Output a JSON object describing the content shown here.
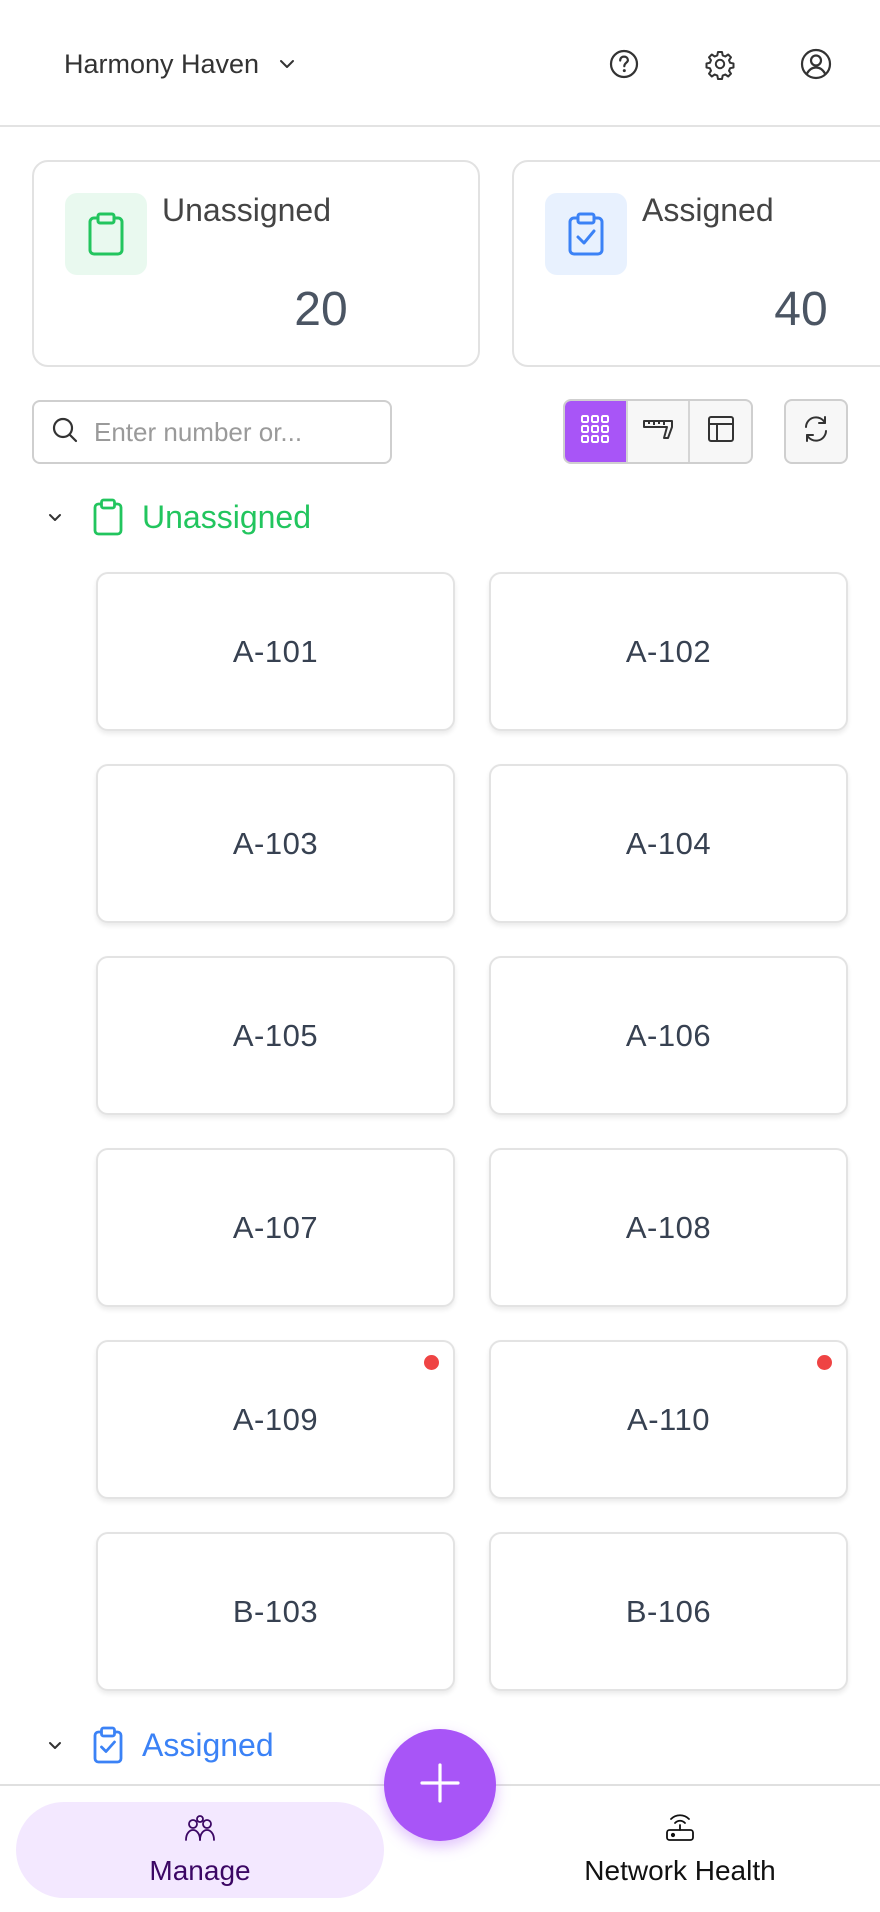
{
  "header": {
    "property_name": "Harmony Haven",
    "icons": [
      "chevron-down-icon",
      "help-icon",
      "settings-icon",
      "profile-icon"
    ]
  },
  "summary": [
    {
      "title": "Unassigned",
      "count": "20",
      "icon": "clipboard-icon",
      "color": "#22c55e",
      "bg": "#e9f9ef"
    },
    {
      "title": "Assigned",
      "count": "40",
      "icon": "clipboard-check-icon",
      "color": "#3b82f6",
      "bg": "#e8f1fe"
    }
  ],
  "search": {
    "placeholder": "Enter number or...",
    "value": ""
  },
  "view_modes": [
    {
      "name": "grid-view",
      "icon": "grid-icon",
      "active": true
    },
    {
      "name": "ruler-view",
      "icon": "ruler-icon",
      "active": false
    },
    {
      "name": "table-view",
      "icon": "table-icon",
      "active": false
    }
  ],
  "sections": {
    "unassigned": {
      "label": "Unassigned",
      "color": "#22c55e",
      "units": [
        {
          "label": "A-101",
          "alert": false
        },
        {
          "label": "A-102",
          "alert": false
        },
        {
          "label": "A-103",
          "alert": false
        },
        {
          "label": "A-104",
          "alert": false
        },
        {
          "label": "A-105",
          "alert": false
        },
        {
          "label": "A-106",
          "alert": false
        },
        {
          "label": "A-107",
          "alert": false
        },
        {
          "label": "A-108",
          "alert": false
        },
        {
          "label": "A-109",
          "alert": true
        },
        {
          "label": "A-110",
          "alert": true
        },
        {
          "label": "B-103",
          "alert": false
        },
        {
          "label": "B-106",
          "alert": false
        }
      ]
    },
    "assigned": {
      "label": "Assigned",
      "color": "#3b82f6"
    }
  },
  "bottom_nav": {
    "manage": {
      "label": "Manage",
      "icon": "people-icon",
      "active": true
    },
    "network": {
      "label": "Network Health",
      "icon": "router-icon",
      "active": false
    }
  },
  "fab": {
    "icon": "plus-icon"
  },
  "colors": {
    "accent": "#a855f7",
    "alert": "#ef4444"
  }
}
